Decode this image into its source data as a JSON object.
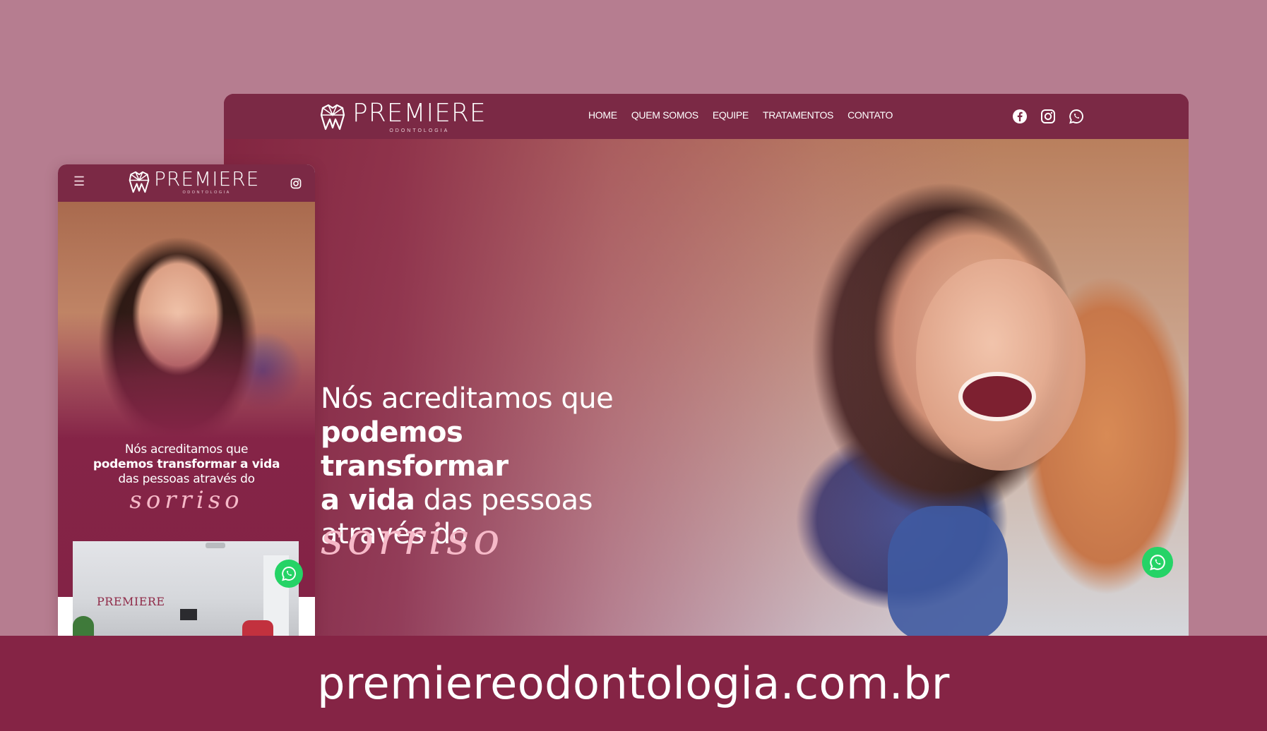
{
  "brand": {
    "name": "PREMIERE",
    "subtitle": "ODONTOLOGIA"
  },
  "desktop": {
    "nav": [
      {
        "label": "HOME"
      },
      {
        "label": "QUEM SOMOS"
      },
      {
        "label": "EQUIPE"
      },
      {
        "label": "TRATAMENTOS"
      },
      {
        "label": "CONTATO"
      }
    ],
    "social_icons": [
      "facebook-icon",
      "instagram-icon",
      "whatsapp-icon"
    ],
    "hero": {
      "line1": "Nós acreditamos que",
      "line2_bold": "podemos transformar",
      "line3_bold": "a vida",
      "line3_rest": " das pessoas",
      "line4": "através do",
      "script": "sorriso"
    }
  },
  "mobile": {
    "menu_icon": "☰",
    "hero": {
      "line1": "Nós acreditamos que",
      "line2_bold": "podemos transformar a vida",
      "line3": "das pessoas através do",
      "script": "sorriso"
    },
    "photo_wall_logo": "PREMIERE"
  },
  "footer": {
    "url": "premiereodontologia.com.br"
  },
  "colors": {
    "background": "#b67d90",
    "brand_wine": "#7b2945",
    "footer": "#852445",
    "script_pink": "#f6b9c8",
    "whatsapp_green": "#25d366"
  }
}
